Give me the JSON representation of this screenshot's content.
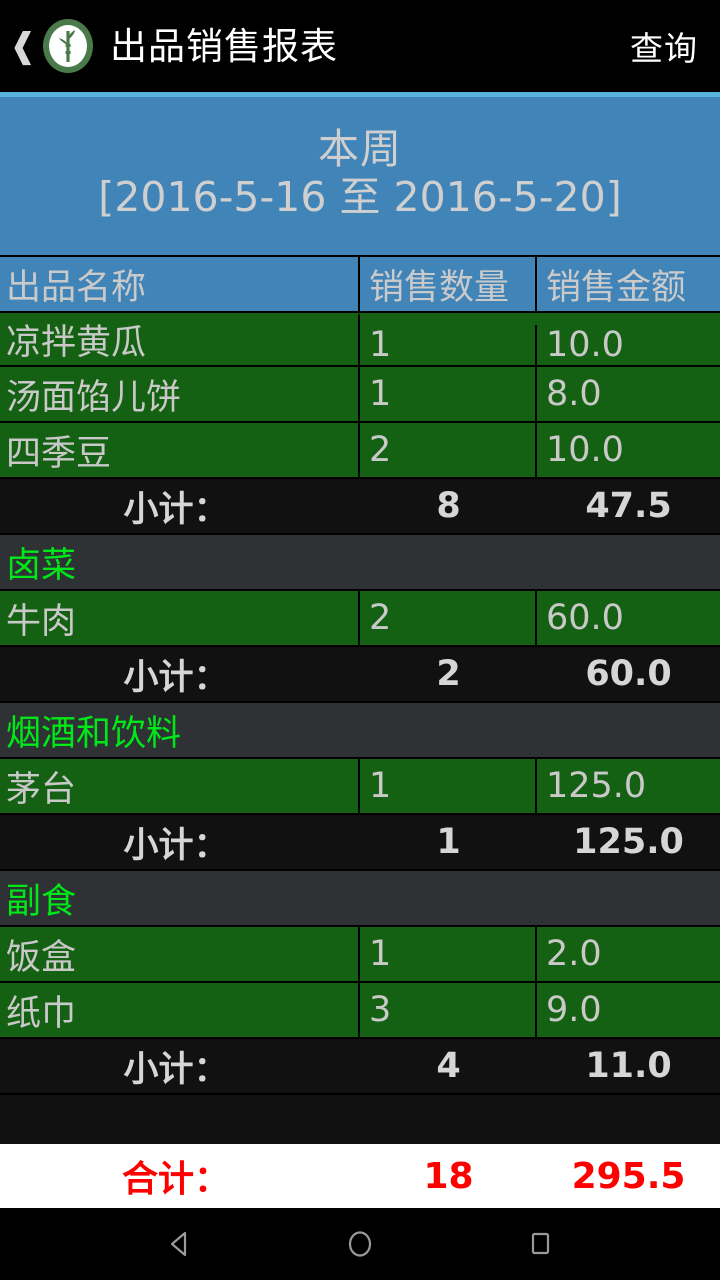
{
  "appbar": {
    "back_icon": "chevron-left-icon",
    "logo_icon": "bamboo-leaf-logo-icon",
    "title": "出品销售报表",
    "action_label": "查询"
  },
  "period": {
    "label": "本周",
    "range": "[2016-5-16 至 2016-5-20]"
  },
  "table": {
    "columns": [
      "出品名称",
      "销售数量",
      "销售金额"
    ],
    "subtotal_label": "小计：",
    "total_label": "合计：",
    "groups": [
      {
        "category": "",
        "rows": [
          {
            "name": "凉拌黄瓜",
            "qty": "1",
            "amount": "10.0"
          },
          {
            "name": "汤面馅儿饼",
            "qty": "1",
            "amount": "8.0"
          },
          {
            "name": "四季豆",
            "qty": "2",
            "amount": "10.0"
          }
        ],
        "subtotal": {
          "qty": "8",
          "amount": "47.5"
        }
      },
      {
        "category": "卤菜",
        "rows": [
          {
            "name": "牛肉",
            "qty": "2",
            "amount": "60.0"
          }
        ],
        "subtotal": {
          "qty": "2",
          "amount": "60.0"
        }
      },
      {
        "category": "烟酒和饮料",
        "rows": [
          {
            "name": "茅台",
            "qty": "1",
            "amount": "125.0"
          }
        ],
        "subtotal": {
          "qty": "1",
          "amount": "125.0"
        }
      },
      {
        "category": "副食",
        "rows": [
          {
            "name": "饭盒",
            "qty": "1",
            "amount": "2.0"
          },
          {
            "name": "纸巾",
            "qty": "3",
            "amount": "9.0"
          }
        ],
        "subtotal": {
          "qty": "4",
          "amount": "11.0"
        }
      }
    ],
    "total": {
      "qty": "18",
      "amount": "295.5"
    }
  },
  "navbar": {
    "back_icon": "triangle-back-icon",
    "home_icon": "circle-home-icon",
    "recents_icon": "square-recents-icon"
  },
  "colors": {
    "appbar_bg": "#000000",
    "accent_line": "#56b4dd",
    "banner_blue": "#4184b8",
    "row_green": "#156113",
    "category_bg": "#2e3234",
    "subtotal_bg": "#111111",
    "category_text": "#00e818",
    "total_text": "#ff0000",
    "total_bg": "#ffffff"
  }
}
